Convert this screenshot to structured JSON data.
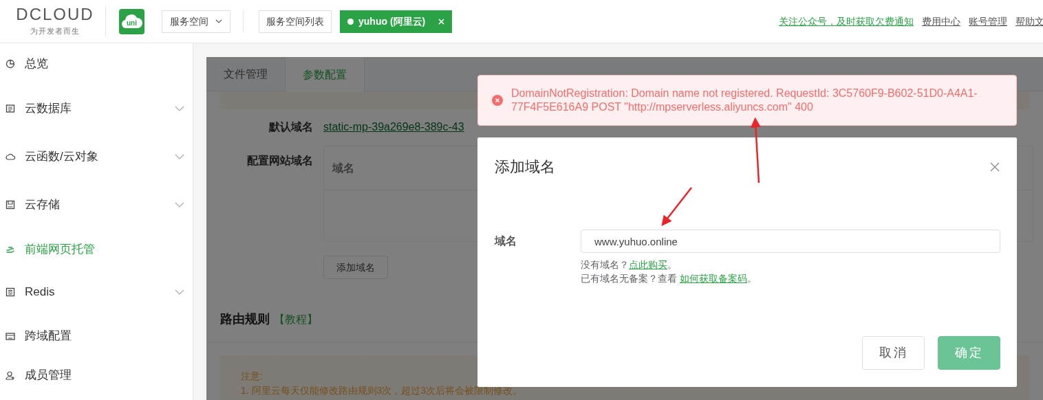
{
  "header": {
    "logo": {
      "wordmark": "DCLOUD",
      "tagline": "为开发者而生"
    },
    "app_badge": "uni",
    "space_dropdown": "服务空间",
    "space_list_button": "服务空间列表",
    "current_space": {
      "label": "yuhuo (阿里云)"
    },
    "links": [
      {
        "label": "关注公众号，及时获取欠费通知",
        "kind": "highlight"
      },
      {
        "label": "费用中心",
        "kind": "normal"
      },
      {
        "label": "账号管理",
        "kind": "normal"
      },
      {
        "label": "帮助文",
        "kind": "normal"
      }
    ]
  },
  "sidebar": {
    "items": [
      {
        "label": "总览",
        "expandable": false,
        "selected": false
      },
      {
        "label": "云数据库",
        "expandable": true,
        "selected": false
      },
      {
        "label": "云函数/云对象",
        "expandable": true,
        "selected": false
      },
      {
        "label": "云存储",
        "expandable": true,
        "selected": false
      },
      {
        "label": "前端网页托管",
        "expandable": false,
        "selected": true
      },
      {
        "label": "Redis",
        "expandable": true,
        "selected": false
      },
      {
        "label": "跨域配置",
        "expandable": false,
        "selected": false
      },
      {
        "label": "成员管理",
        "expandable": false,
        "selected": false
      }
    ]
  },
  "content": {
    "tabs": [
      {
        "label": "文件管理",
        "selected": false
      },
      {
        "label": "参数配置",
        "selected": true
      }
    ],
    "default_domain": {
      "label": "默认域名",
      "value": "static-mp-39a269e8-389c-43"
    },
    "site_domain": {
      "label": "配置网站域名",
      "column": "域名"
    },
    "add_button": "添加域名",
    "routing": {
      "title": "路由规则",
      "link": "【教程】"
    },
    "notice": {
      "title": "注意:",
      "lines": [
        "1. 阿里云每天仅能修改路由规则3次，超过3次后将会被限制修改。"
      ]
    }
  },
  "toast": {
    "kind": "error",
    "message": "DomainNotRegistration: Domain name not registered. RequestId: 3C5760F9-B602-51D0-A4A1-77F4F5E616A9 POST \"http://mpserverless.aliyuncs.com\" 400"
  },
  "dialog": {
    "title": "添加域名",
    "field": {
      "label": "域名",
      "value": "www.yuhuo.online"
    },
    "hints": [
      {
        "text": "没有域名？",
        "link": "点此购买",
        "end": "。"
      },
      {
        "text": "已有域名无备案？查看 ",
        "link": "如何获取备案码",
        "end": "。"
      }
    ],
    "buttons": [
      {
        "label": "取消",
        "kind": "default"
      },
      {
        "label": "确定",
        "kind": "primary"
      }
    ]
  }
}
